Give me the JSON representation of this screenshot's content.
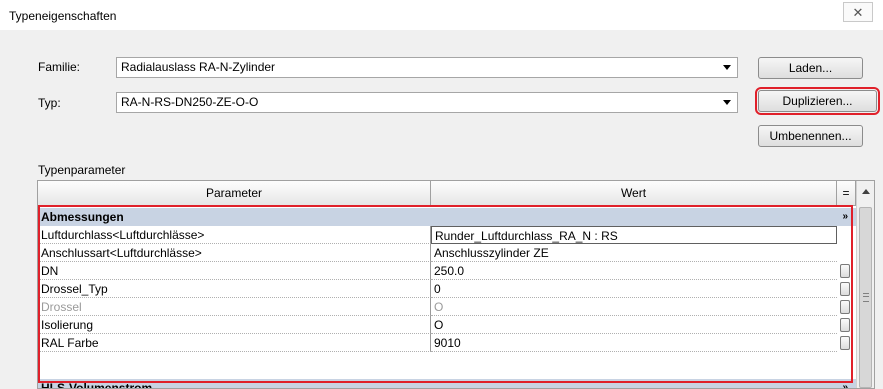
{
  "dialog": {
    "title": "Typeneigenschaften",
    "close_glyph": "☒"
  },
  "familie": {
    "label": "Familie:",
    "value": "Radialauslass RA-N-Zylinder"
  },
  "typ": {
    "label": "Typ:",
    "value": "RA-N-RS-DN250-ZE-O-O"
  },
  "buttons": {
    "laden": "Laden...",
    "duplizieren": "Duplizieren...",
    "umbenennen": "Umbenennen..."
  },
  "typenparameter": {
    "label": "Typenparameter",
    "header_parameter": "Parameter",
    "header_wert": "Wert",
    "header_eq": "=",
    "groups": [
      {
        "name": "Abmessungen",
        "caret": "»",
        "rows": [
          {
            "parameter": "Luftdurchlass<Luftdurchlässe>",
            "wert": "Runder_Luftdurchlass_RA_N : RS",
            "editing": true,
            "disabled": false,
            "assoc": false
          },
          {
            "parameter": "Anschlussart<Luftdurchlässe>",
            "wert": "Anschlusszylinder ZE",
            "editing": false,
            "disabled": false,
            "assoc": false
          },
          {
            "parameter": "DN",
            "wert": "250.0",
            "editing": false,
            "disabled": false,
            "assoc": true
          },
          {
            "parameter": "Drossel_Typ",
            "wert": "0",
            "editing": false,
            "disabled": false,
            "assoc": true
          },
          {
            "parameter": "Drossel",
            "wert": "O",
            "editing": false,
            "disabled": true,
            "assoc": true
          },
          {
            "parameter": "Isolierung",
            "wert": "O",
            "editing": false,
            "disabled": false,
            "assoc": true
          },
          {
            "parameter": "RAL Farbe",
            "wert": "9010",
            "editing": false,
            "disabled": false,
            "assoc": true
          }
        ]
      },
      {
        "name": "HLS-Volumenstrom",
        "caret": "»"
      }
    ]
  },
  "colors": {
    "highlight": "#e0202a",
    "group_header": "#c8d3e3"
  }
}
